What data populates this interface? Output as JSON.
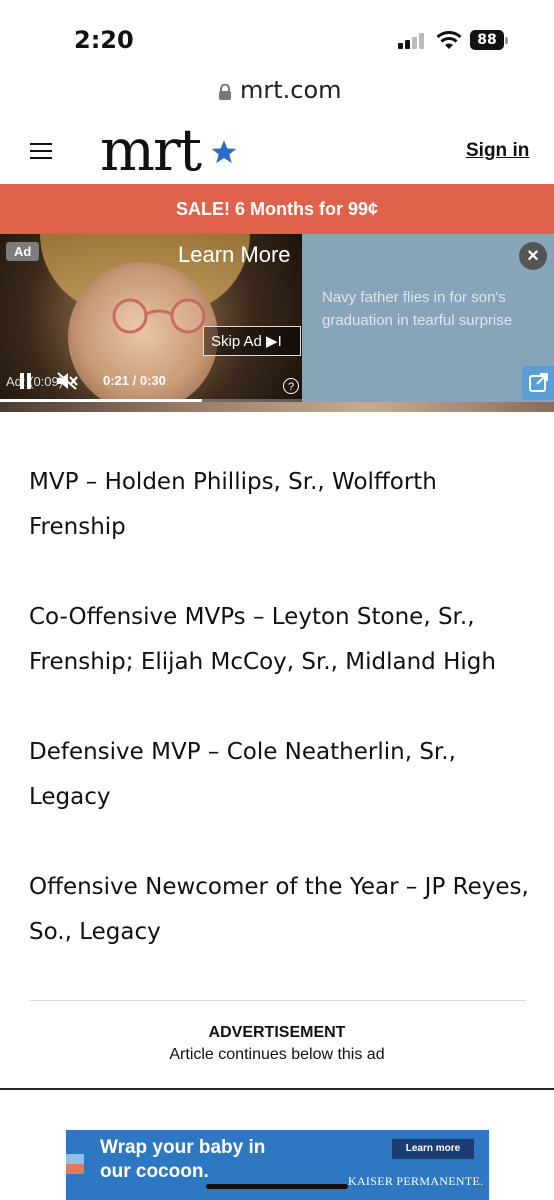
{
  "status_bar": {
    "time": "2:20",
    "battery": "88"
  },
  "browser": {
    "url": "mrt.com"
  },
  "header": {
    "logo": "mrt",
    "sign_in": "Sign in"
  },
  "sale_banner": {
    "text": "SALE! 6 Months for 99¢"
  },
  "video_ad": {
    "ad_tag": "Ad",
    "learn_more": "Learn More",
    "skip_ad": "Skip Ad ▶I",
    "ad_time_label": "Ad: (0:09)",
    "time": "0:21 / 0:30",
    "progress": 0.67,
    "help": "?",
    "headline": "Navy father flies in for son's graduation in tearful surprise",
    "close": "×"
  },
  "article": {
    "paragraphs": [
      "MVP – Holden Phillips, Sr., Wolfforth Frenship",
      "Co-Offensive MVPs – Leyton Stone, Sr., Frenship; Elijah McCoy, Sr., Midland High",
      "Defensive MVP – Cole Neatherlin, Sr., Legacy",
      "Offensive Newcomer of the Year – JP Reyes, So., Legacy"
    ]
  },
  "advertisement": {
    "label": "ADVERTISEMENT",
    "sub": "Article continues below this ad"
  },
  "banner_ad": {
    "text": "Wrap your baby in our cocoon.",
    "button": "Learn more",
    "brand": "KAISER PERMANENTE."
  },
  "colors": {
    "sale_banner": "#e0614c",
    "banner_ad": "#2e78c2",
    "logo_star": "#2d6cc6"
  }
}
